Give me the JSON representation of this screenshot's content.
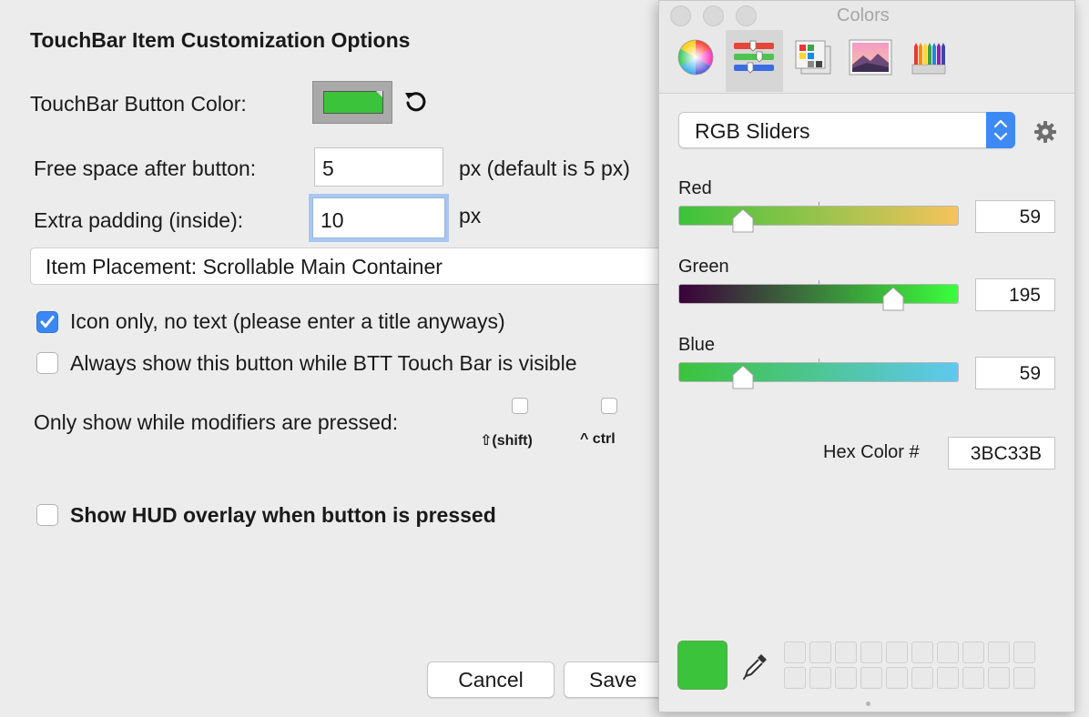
{
  "main": {
    "title": "TouchBar Item Customization Options",
    "button_color_label": "TouchBar Button Color:",
    "button_color": "#3BC33B",
    "free_space": {
      "label": "Free space after button:",
      "value": "5",
      "unit": "px (default is 5 px)"
    },
    "extra_padding": {
      "label": "Extra padding (inside):",
      "value": "10",
      "unit": "px"
    },
    "placement": "Item Placement: Scrollable Main Container",
    "icon_only": {
      "label": "Icon only, no text (please enter a title anyways)",
      "checked": true
    },
    "always_show": {
      "label": "Always show this button while BTT Touch Bar is visible",
      "checked": false
    },
    "modifiers": {
      "label": "Only show while modifiers are pressed:",
      "items": [
        {
          "label": "⇧(shift)",
          "checked": false
        },
        {
          "label": "^ ctrl",
          "checked": false
        }
      ]
    },
    "show_hud": {
      "label": "Show HUD overlay when button is pressed",
      "checked": false
    },
    "cancel_label": "Cancel",
    "save_label": "Save"
  },
  "colors_panel": {
    "title": "Colors",
    "mode": "RGB Sliders",
    "tabs": [
      "color-wheel",
      "color-sliders",
      "color-palettes",
      "image-palettes",
      "pencils"
    ],
    "selected_tab": "color-sliders",
    "sliders": [
      {
        "name": "Red",
        "value": "59",
        "level": 0.231
      },
      {
        "name": "Green",
        "value": "195",
        "level": 0.765
      },
      {
        "name": "Blue",
        "value": "59",
        "level": 0.231
      }
    ],
    "hex_label": "Hex Color #",
    "hex_value": "3BC33B",
    "current_color": "#3BC33B"
  }
}
